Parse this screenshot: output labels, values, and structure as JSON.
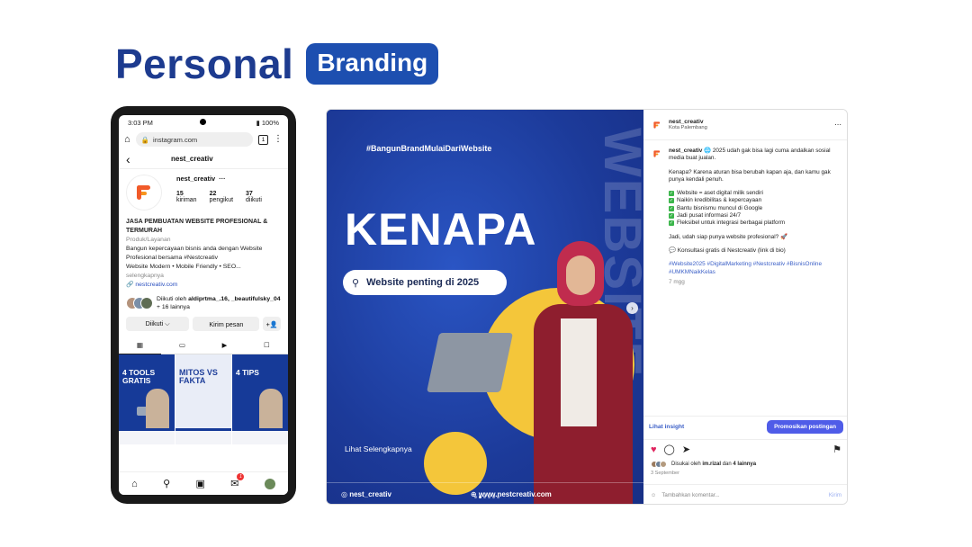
{
  "heading": {
    "title": "Personal",
    "badge": "Branding"
  },
  "phone": {
    "status": {
      "time": "3:03 PM",
      "battery": "100%"
    },
    "browser": {
      "url": "instagram.com",
      "tab_count": "1"
    },
    "profile": {
      "username": "nest_creativ",
      "more": "···",
      "posts_count": "15",
      "posts_label": "kiriman",
      "followers_count": "22",
      "followers_label": "pengikut",
      "following_count": "37",
      "following_label": "diikuti",
      "bio_title": "JASA PEMBUATAN WEBSITE PROFESIONAL & TERMURAH",
      "category": "Produk/Layanan",
      "bio_line1": "Bangun kepercayaan bisnis anda dengan Website Profesional bersama #Nestcreativ",
      "bio_line2": "Website Modern • Mobile Friendly • SEO...",
      "bio_more": "selengkapnya",
      "link": "nestcreativ.com",
      "followed_prefix": "Diikuti oleh ",
      "followed_names": "aldiprtma_.16, _beautifulsky_04",
      "followed_suffix": " + 16 lainnya",
      "follow_button": "Diikuti ⌵",
      "message_button": "Kirim pesan",
      "add_button": "+👤"
    },
    "grid": [
      {
        "title": "4 TOOLS GRATIS"
      },
      {
        "title": "MITOS VS FAKTA"
      },
      {
        "title": "4 TIPS"
      }
    ],
    "nav_badge": "1"
  },
  "post": {
    "media": {
      "hashtag": "#BangunBrandMulaiDariWebsite",
      "vertical_text": "WEBSITE",
      "headline": "KENAPA",
      "pill_text": "Website penting di 2025",
      "see_more": "Lihat Selengkapnya",
      "footer_handle": "nest_creativ",
      "footer_url": "www.nestcreativ.com"
    },
    "panel": {
      "account": "nest_creativ",
      "location": "Kota Palembang",
      "caption_intro": "🌐 2025 udah gak bisa lagi cuma andalkan sosial media buat jualan.",
      "caption_q": "Kenapa? Karena aturan bisa berubah kapan aja, dan kamu gak punya kendali penuh.",
      "checks": [
        "Website = aset digital milik sendiri",
        "Naikin kredibilitas & kepercayaan",
        "Bantu bisnismu muncul di Google",
        "Jadi pusat informasi 24/7",
        "Fleksibel untuk integrasi berbagai platform"
      ],
      "caption_ask": "Jadi, udah siap punya website profesional? 🚀",
      "caption_cta": "💬 Konsultasi gratis di Nestcreativ (link di bio)",
      "tags": "#Website2025 #DigitalMarketing #Nestcreativ #BisnisOnline #UMKMNaikKelas",
      "time_ago": "7 mgg",
      "insight": "Lihat insight",
      "promote": "Promosikan postingan",
      "liked_by_prefix": "Disukai oleh ",
      "liked_by_name": "im.rizal",
      "liked_by_suffix": " dan ",
      "liked_by_others": "4 lainnya",
      "date": "3 September",
      "comment_placeholder": "Tambahkan komentar...",
      "send": "Kirim"
    }
  }
}
